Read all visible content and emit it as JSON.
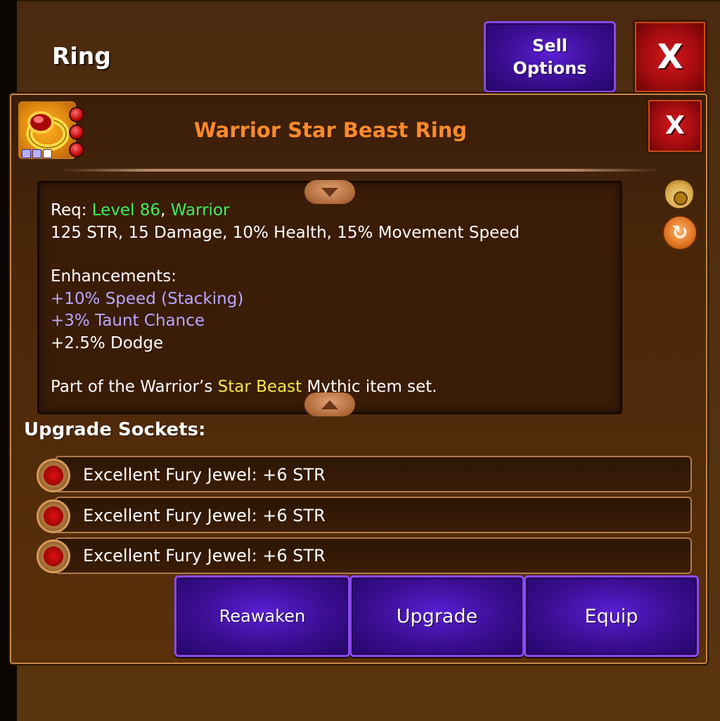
{
  "screen": {
    "title": "Ring"
  },
  "header_buttons": {
    "sell_line1": "Sell",
    "sell_line2": "Options",
    "close_glyph": "X"
  },
  "item": {
    "name": "Warrior Star Beast Ring",
    "close_glyph": "X",
    "icon": "gold-ruby-ring-icon",
    "colors": {
      "name": "#ff8a2a",
      "requirement": "#3df05a",
      "enhancement": "#b7a8ff",
      "set_name": "#f4e84a"
    }
  },
  "description": {
    "req_prefix": "Req: ",
    "req_level": "Level 86",
    "req_sep": ", ",
    "req_class": "Warrior",
    "stats": "125 STR, 15 Damage, 10% Health, 15% Movement Speed",
    "enhancements_heading": "Enhancements:",
    "enhancements": [
      "+10% Speed (Stacking)",
      "+3% Taunt Chance",
      "+2.5% Dodge"
    ],
    "set_prefix": "Part of the Warrior’s ",
    "set_name": "Star Beast",
    "set_suffix": " Mythic item set."
  },
  "side_icons": {
    "sell": "money-bag-icon",
    "swap": "swap-arrows-icon",
    "swap_glyph": "↻"
  },
  "sockets": {
    "heading": "Upgrade Sockets:",
    "items": [
      "Excellent Fury Jewel: +6 STR",
      "Excellent Fury Jewel: +6 STR",
      "Excellent Fury Jewel: +6 STR"
    ]
  },
  "actions": {
    "reawaken": "Reawaken",
    "upgrade": "Upgrade",
    "equip": "Equip"
  }
}
